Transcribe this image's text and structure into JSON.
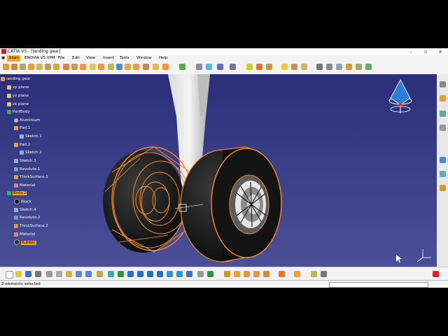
{
  "window": {
    "title": "CATIA V5 - [landing gear]"
  },
  "menubar": {
    "items": [
      "Start",
      "ENOVIA V5 VPM",
      "File",
      "Edit",
      "View",
      "Insert",
      "Tools",
      "Window",
      "Help"
    ]
  },
  "tree": {
    "root": "landing gear",
    "nodes": [
      {
        "label": "xy plane",
        "icon": "plane-icon"
      },
      {
        "label": "yz plane",
        "icon": "plane-icon"
      },
      {
        "label": "zx plane",
        "icon": "plane-icon"
      },
      {
        "label": "PartBody",
        "icon": "gear-icon"
      },
      {
        "label": "Aluminium",
        "icon": "material-icon"
      },
      {
        "label": "Pad.1",
        "icon": "pad-icon"
      },
      {
        "label": "Sketch.1",
        "icon": "sketch-icon"
      },
      {
        "label": "Pad.2",
        "icon": "pad-icon"
      },
      {
        "label": "Sketch.2",
        "icon": "sketch-icon"
      },
      {
        "label": "Sketch.3",
        "icon": "sketch-icon"
      },
      {
        "label": "Revolute.1",
        "icon": "revolute-icon"
      },
      {
        "label": "ThickSurface.1",
        "icon": "thick-surface-icon"
      },
      {
        "label": "Material",
        "icon": "material-icon"
      },
      {
        "label": "Body.2",
        "icon": "gear-icon",
        "highlight": true
      },
      {
        "label": "Black",
        "icon": "material-icon"
      },
      {
        "label": "Sketch.4",
        "icon": "sketch-icon"
      },
      {
        "label": "Revolute.2",
        "icon": "revolute-icon"
      },
      {
        "label": "ThickSurface.2",
        "icon": "thick-surface-icon"
      },
      {
        "label": "Material",
        "icon": "material-icon"
      },
      {
        "label": "Rubber",
        "icon": "material-icon",
        "highlight": true
      }
    ]
  },
  "status": {
    "message": "2 elements selected"
  },
  "colors": {
    "viewport_top": "#2b2f7a",
    "viewport_bottom": "#4a4f97",
    "selection": "#f5a623"
  }
}
